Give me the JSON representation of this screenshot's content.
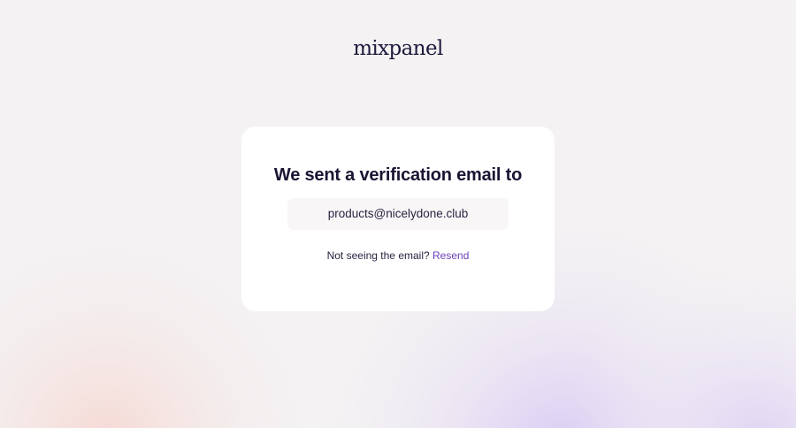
{
  "brand": {
    "logo_text": "mixpanel"
  },
  "verification": {
    "title": "We sent a verification email to",
    "email": "products@nicelydone.club",
    "prompt": "Not seeing the email?",
    "resend_label": "Resend"
  },
  "colors": {
    "background": "#f4f2f3",
    "card": "#ffffff",
    "text": "#1c1433",
    "link": "#6b3fb8",
    "email_box": "#f9f6f7"
  }
}
